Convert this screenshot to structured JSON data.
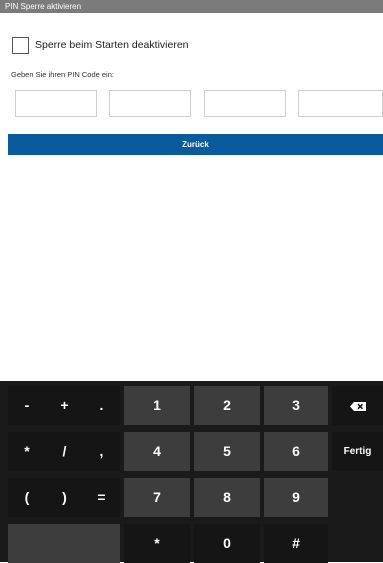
{
  "title": "PIN Sperre aktivieren",
  "disable_on_start_label": "Sperre beim Starten deaktivieren",
  "disable_on_start_checked": false,
  "instruction": "Geben Sie ihren PIN Code ein:",
  "pin_fields": [
    "",
    "",
    "",
    ""
  ],
  "back_button_label": "Zurück",
  "keyboard": {
    "row1": [
      "-",
      "+",
      ".",
      "1",
      "2",
      "3"
    ],
    "row2": [
      "*",
      "/",
      ",",
      "4",
      "5",
      "6"
    ],
    "row3": [
      "(",
      ")",
      "=",
      "7",
      "8",
      "9"
    ],
    "row4": [
      "*",
      "0",
      "#"
    ],
    "done_label": "Fertig",
    "backspace_icon": "backspace-icon"
  }
}
